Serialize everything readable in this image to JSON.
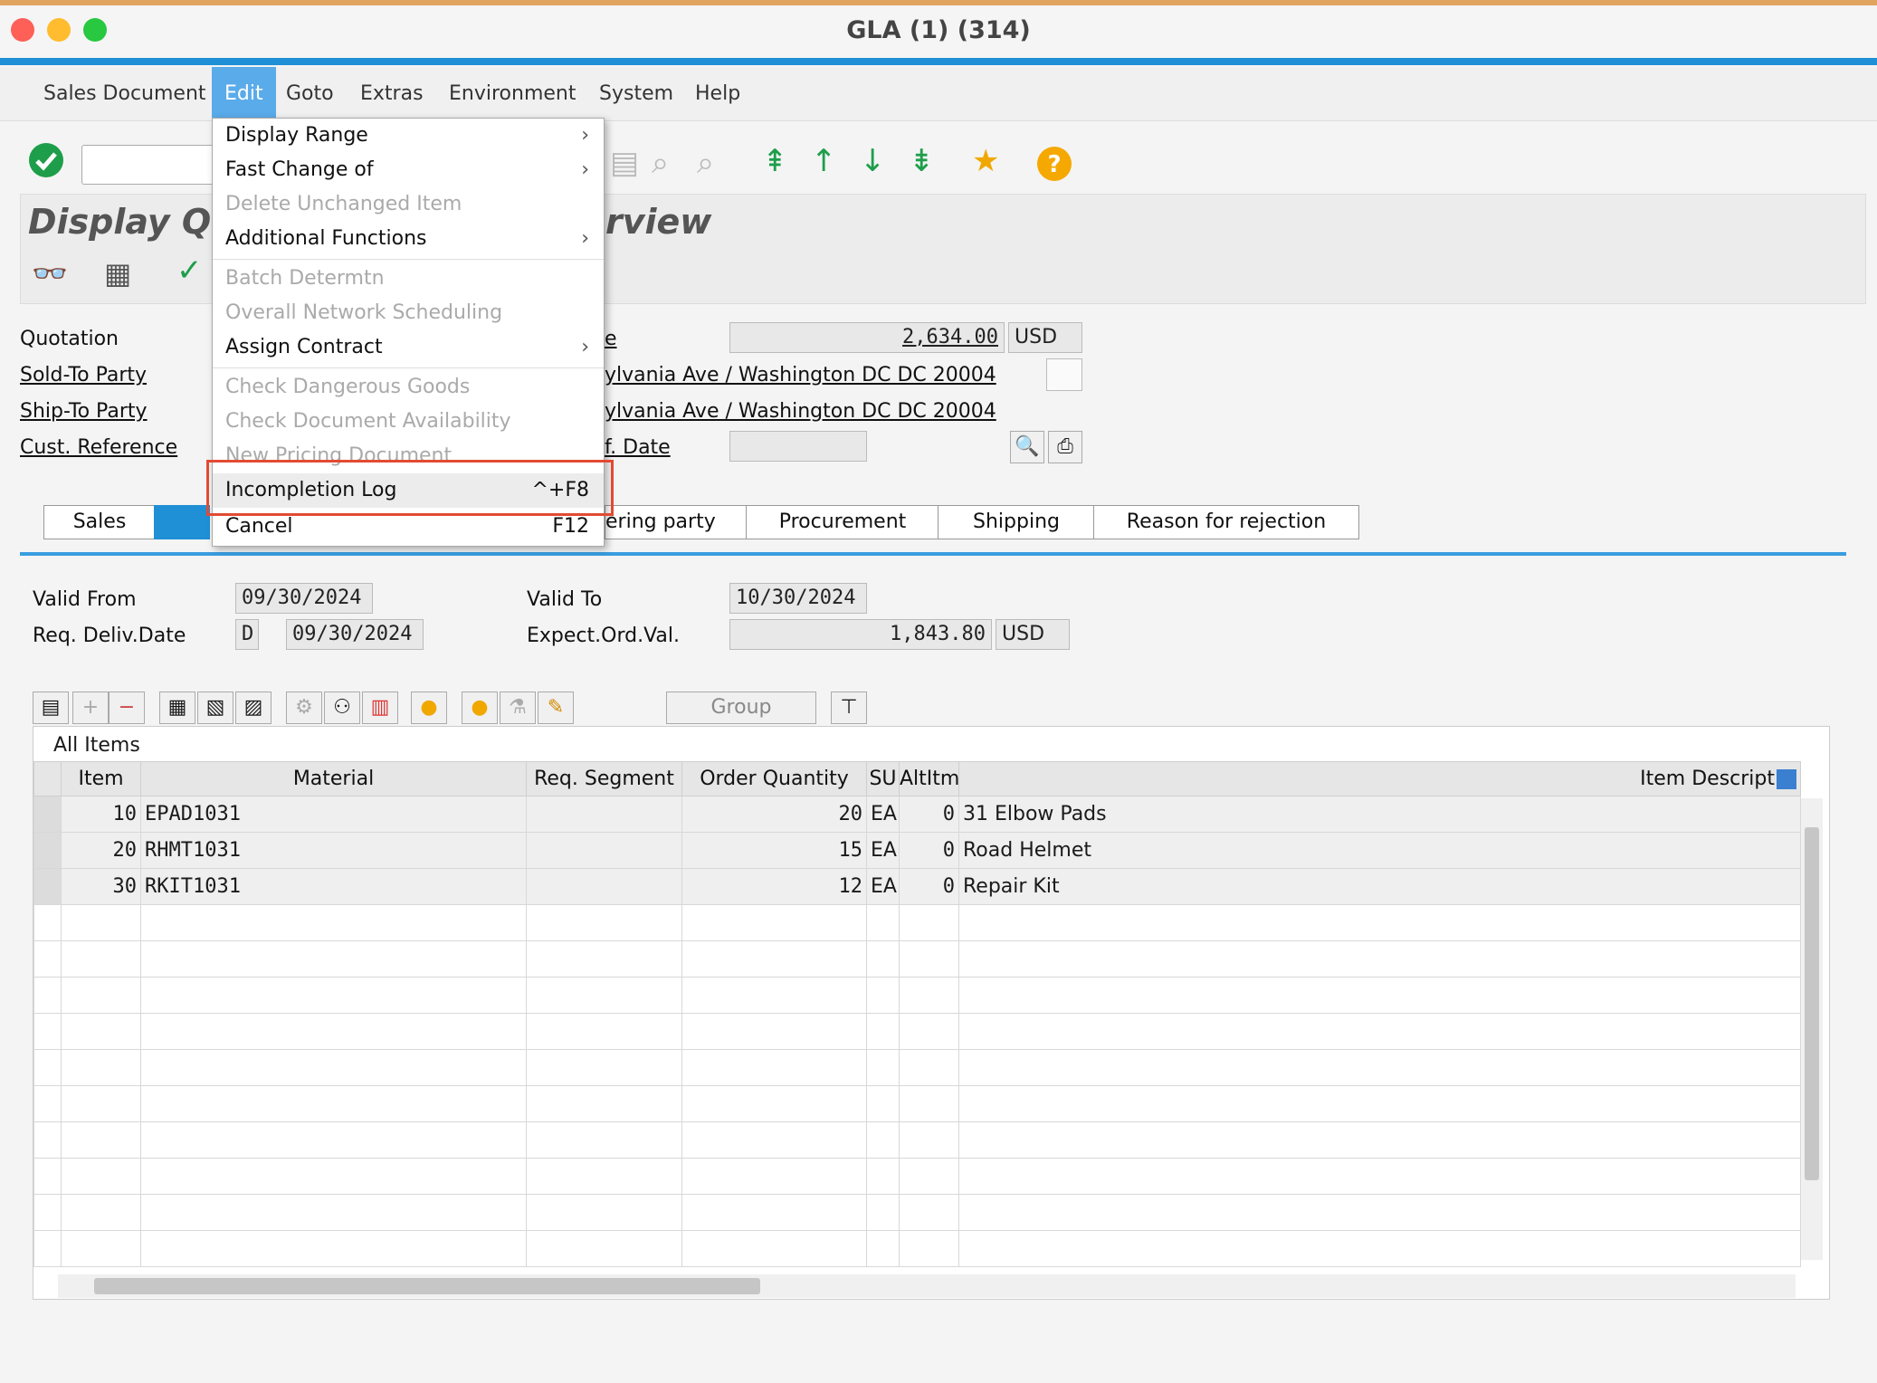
{
  "window": {
    "title": "GLA (1) (314)"
  },
  "menubar": [
    "Sales Document",
    "Edit",
    "Goto",
    "Extras",
    "Environment",
    "System",
    "Help"
  ],
  "page_title_left": "Display Qu",
  "page_title_right": "rview",
  "header": {
    "quotation_label": "Quotation",
    "sold_to_label": "Sold-To Party",
    "ship_to_label": "Ship-To Party",
    "cust_ref_label": "Cust. Reference",
    "net_value_label_frag": "e",
    "net_value": "2,634.00",
    "currency": "USD",
    "sold_to_addr": "ylvania Ave / Washington DC DC 20004",
    "ship_to_addr": "ylvania Ave / Washington DC DC 20004",
    "ref_date_label_frag": "f. Date"
  },
  "tabs": [
    "Sales",
    "ering party",
    "Procurement",
    "Shipping",
    "Reason for rejection"
  ],
  "dates": {
    "valid_from_label": "Valid From",
    "valid_from": "09/30/2024",
    "valid_to_label": "Valid To",
    "valid_to": "10/30/2024",
    "req_deliv_label": "Req. Deliv.Date",
    "req_deliv_type": "D",
    "req_deliv": "09/30/2024",
    "exp_ord_label": "Expect.Ord.Val.",
    "exp_ord_val": "1,843.80",
    "exp_currency": "USD"
  },
  "group_button": "Group",
  "grid": {
    "title": "All Items",
    "columns": [
      "Item",
      "Material",
      "Req. Segment",
      "Order Quantity",
      "SU",
      "AltItm",
      "Item Descript"
    ],
    "rows": [
      {
        "item": "10",
        "material": "EPAD1031",
        "seg": "",
        "qty": "20",
        "su": "EA",
        "alt": "0",
        "desc": "31 Elbow Pads"
      },
      {
        "item": "20",
        "material": "RHMT1031",
        "seg": "",
        "qty": "15",
        "su": "EA",
        "alt": "0",
        "desc": "Road Helmet"
      },
      {
        "item": "30",
        "material": "RKIT1031",
        "seg": "",
        "qty": "12",
        "su": "EA",
        "alt": "0",
        "desc": "Repair Kit"
      }
    ]
  },
  "edit_menu": [
    {
      "label": "Display Range",
      "enabled": true,
      "submenu": true
    },
    {
      "label": "Fast Change of",
      "enabled": true,
      "submenu": true
    },
    {
      "label": "Delete Unchanged Item",
      "enabled": false
    },
    {
      "label": "Additional Functions",
      "enabled": true,
      "submenu": true
    },
    {
      "label": "Batch Determtn",
      "enabled": false
    },
    {
      "label": "Overall Network Scheduling",
      "enabled": false
    },
    {
      "label": "Assign Contract",
      "enabled": true,
      "submenu": true
    },
    {
      "label": "Check Dangerous Goods",
      "enabled": false
    },
    {
      "label": "Check Document Availability",
      "enabled": false
    },
    {
      "label": "New Pricing Document",
      "enabled": false
    },
    {
      "label": "Incompletion Log",
      "enabled": true,
      "shortcut": "^+F8"
    },
    {
      "label": "Cancel",
      "enabled": true,
      "shortcut": "F12"
    }
  ]
}
